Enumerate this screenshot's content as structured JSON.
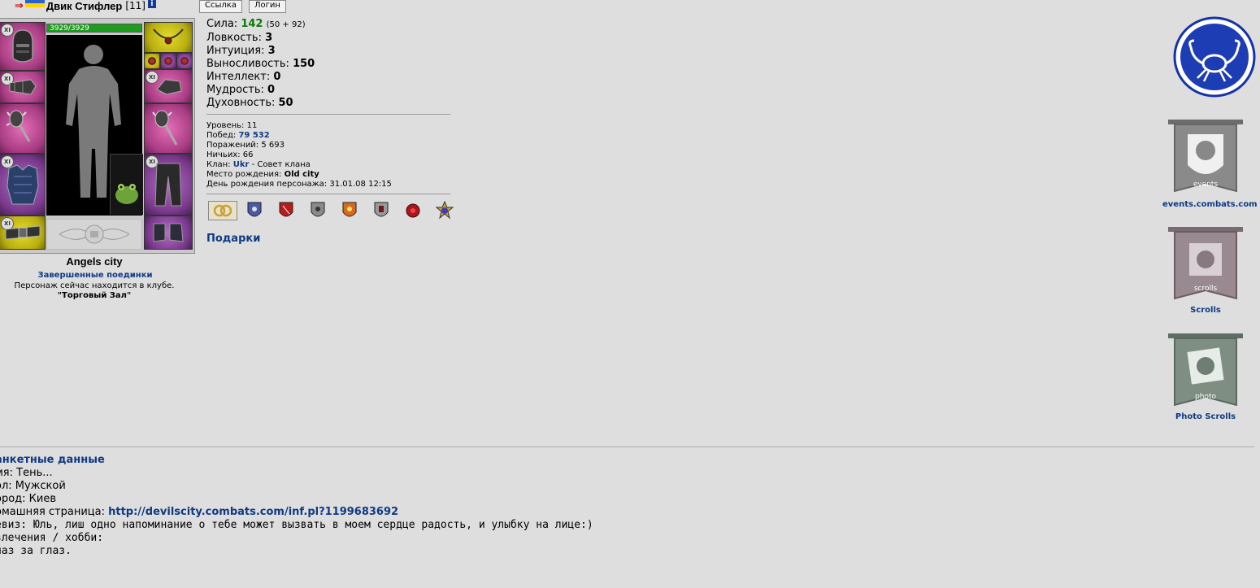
{
  "header": {
    "nick": "Двик Стифлер",
    "level": "[11]",
    "info_icon": "info-icon",
    "link_button": "Ссылка",
    "login_button": "Логин"
  },
  "character": {
    "hp": "3929/3929",
    "hp_fraction": 1.0,
    "city": "Angels city",
    "duels_link": "Завершенные поединки",
    "location_text": "Персонаж сейчас находится в клубе.",
    "location_name": "\"Торговый Зал\""
  },
  "stats": [
    {
      "label": "Сила:",
      "value": "142",
      "extra": "(50 + 92)"
    },
    {
      "label": "Ловкость:",
      "value": "3"
    },
    {
      "label": "Интуиция:",
      "value": "3"
    },
    {
      "label": "Выносливость:",
      "value": "150"
    },
    {
      "label": "Интеллект:",
      "value": "0"
    },
    {
      "label": "Мудрость:",
      "value": "0"
    },
    {
      "label": "Духовность:",
      "value": "50"
    }
  ],
  "info": {
    "level": {
      "label": "Уровень:",
      "value": "11"
    },
    "wins": {
      "label": "Побед:",
      "value": "79 532"
    },
    "losses": {
      "label": "Поражений:",
      "value": "5 693"
    },
    "draws": {
      "label": "Ничьих:",
      "value": "66"
    },
    "clan": {
      "label": "Клан:",
      "value": "Ukr",
      "rank": "- Совет клана"
    },
    "birthplace": {
      "label": "Место рождения:",
      "value": "Old city"
    },
    "birthday": {
      "label": "День рождения персонажа:",
      "value": "31.01.08 12:15"
    }
  },
  "gifts_link": "Подарки",
  "right_panel": {
    "events_caption": "events.combats.com",
    "scrolls_caption": "Scrolls",
    "photo_caption": "Photo Scrolls",
    "events_label": "events",
    "scrolls_label": "scrolls",
    "photo_label": "photo"
  },
  "anketa": {
    "title": "анкетные данные",
    "name": "мя: Тень...",
    "sex": "ол: Мужской",
    "city": "ород: Киев",
    "homepage_label": "омашняя страница: ",
    "homepage_url": "http://devilscity.combats.com/inf.pl?1199683692",
    "motto": "евиз: Юль, лиш одно напоминание о тебе может вызвать в моем сердце радость, и улыбку на лице:)",
    "hobby_label": "влечения / хобби:",
    "hobby": "лаз за глаз."
  },
  "colors": {
    "background": "#dedede",
    "link": "#0f3a82",
    "strength": "#0a7a0a",
    "hp_bar": "#1d9d1d"
  }
}
